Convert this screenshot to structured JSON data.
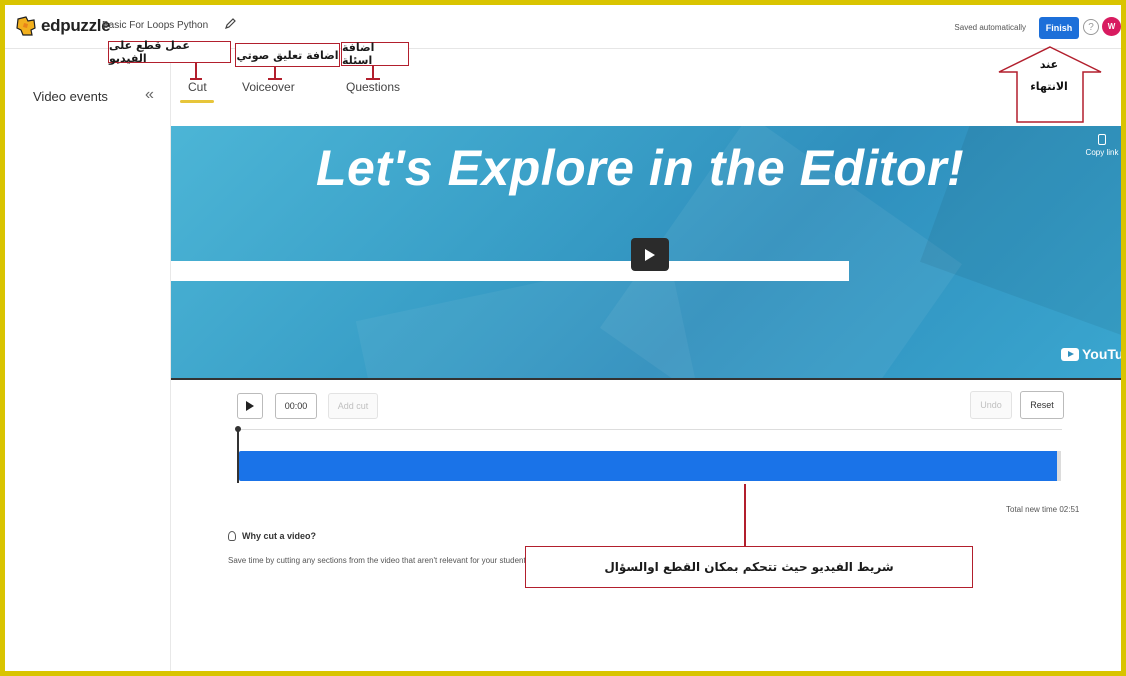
{
  "app": {
    "logo_text": "edpuzzle",
    "video_title": "Basic For Loops Python",
    "saved_status": "Saved automatically",
    "finish_label": "Finish",
    "help_glyph": "?",
    "avatar_initial": "W",
    "brand_color": "#1c6fd9",
    "avatar_color": "#d81b60"
  },
  "sidebar": {
    "title": "Video events",
    "collapse_glyph": "«"
  },
  "tabs": [
    {
      "label": "Cut",
      "active": true
    },
    {
      "label": "Voiceover",
      "active": false
    },
    {
      "label": "Questions",
      "active": false
    }
  ],
  "video": {
    "headline": "Let's Explore in the Editor!",
    "copy_link_label": "Copy link",
    "youtube_label": "YouTube"
  },
  "controls": {
    "time": "00:00",
    "add_cut_label": "Add cut",
    "undo_label": "Undo",
    "reset_label": "Reset",
    "total_time": "Total new time 02:51",
    "timeline_color": "#1a73e8"
  },
  "help": {
    "title": "Why cut a video?",
    "text": "Save time by cutting any sections from the video that aren't relevant for your students."
  },
  "annotations": {
    "cut": "عمل قطع على الفيديو",
    "voiceover": "اضافة تعليق صوتي",
    "questions": "اضافة اسئلة",
    "finish_line1": "عند",
    "finish_line2": "الانتهاء",
    "timeline": "شريط الفيديو حيث تتحكم بمكان القطع اوالسؤال",
    "annotation_color": "#b21f2d"
  }
}
